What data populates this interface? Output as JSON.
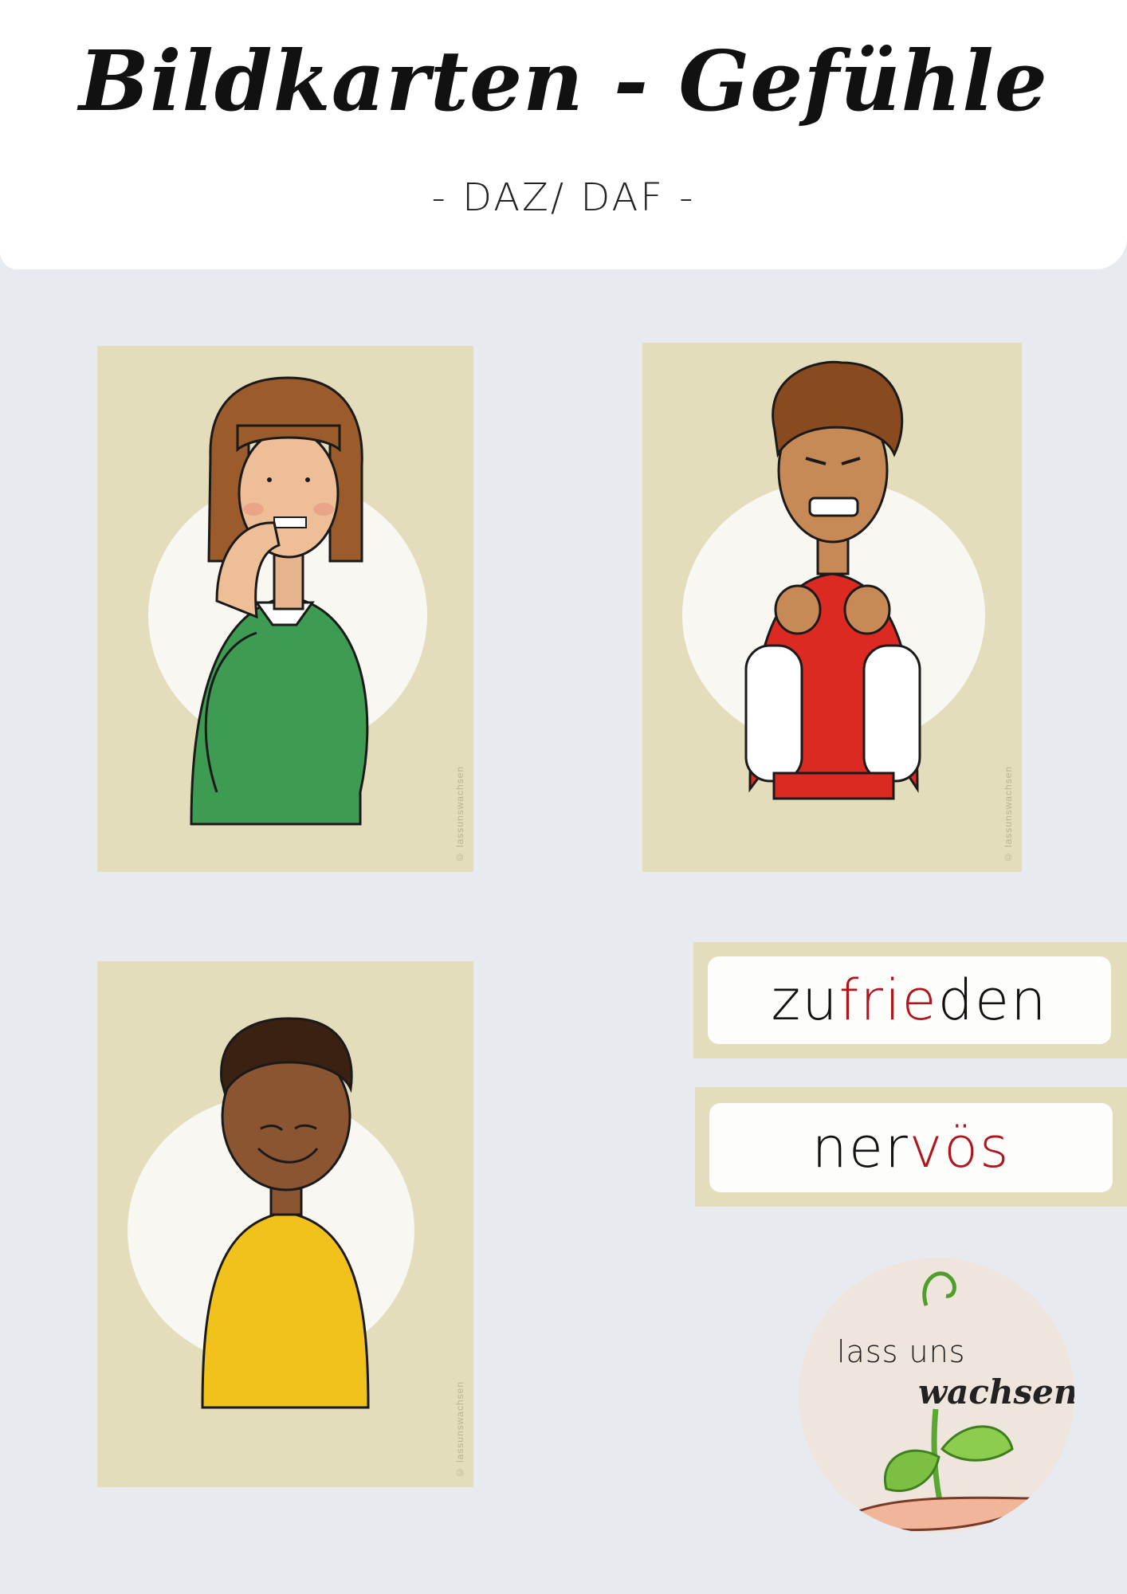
{
  "header": {
    "title": "Bildkarten - Gefühle",
    "subtitle": "- DAZ/ DAF -"
  },
  "cards": [
    {
      "copyright": "© lassunswachsen"
    },
    {
      "copyright": "© lassunswachsen"
    },
    {
      "copyright": "© lassunswachsen"
    }
  ],
  "word_cards": [
    {
      "parts": [
        "zu",
        "frie",
        "den"
      ]
    },
    {
      "parts": [
        "ner",
        "vös"
      ]
    }
  ],
  "logo": {
    "line1": "lass uns",
    "line2": "wachsen"
  },
  "colors": {
    "page_bg": "#e7ebf0",
    "card_bg": "#e3ddbb",
    "accent_red": "#b3141c"
  }
}
